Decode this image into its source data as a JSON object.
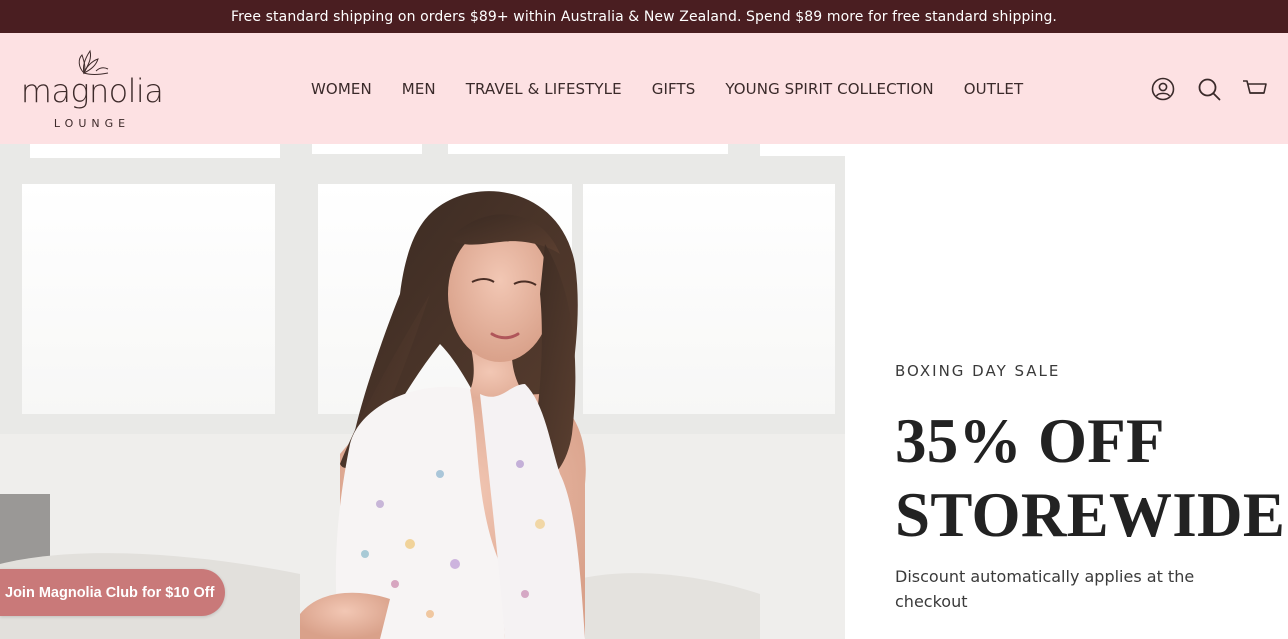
{
  "announcement": {
    "text": "Free standard shipping on orders $89+ within Australia & New Zealand. Spend $89 more for free standard shipping."
  },
  "header": {
    "logo": {
      "wordmark": "magnolia",
      "subtitle": "LOUNGE"
    },
    "nav": [
      {
        "label": "WOMEN"
      },
      {
        "label": "MEN"
      },
      {
        "label": "TRAVEL & LIFESTYLE"
      },
      {
        "label": "GIFTS"
      },
      {
        "label": "YOUNG SPIRIT COLLECTION"
      },
      {
        "label": "OUTLET"
      }
    ],
    "icons": [
      "account-icon",
      "search-icon",
      "cart-icon"
    ]
  },
  "hero": {
    "eyebrow": "BOXING DAY SALE",
    "headline_line1": "35% OFF",
    "headline_line2": "STOREWIDE",
    "subtext": "Discount automatically applies at the checkout"
  },
  "club_button": {
    "label": "Join Magnolia Club for $10 Off"
  },
  "colors": {
    "announcement_bg": "#4a1e21",
    "header_bg": "#fde1e3",
    "club_button_bg": "#c97979"
  }
}
